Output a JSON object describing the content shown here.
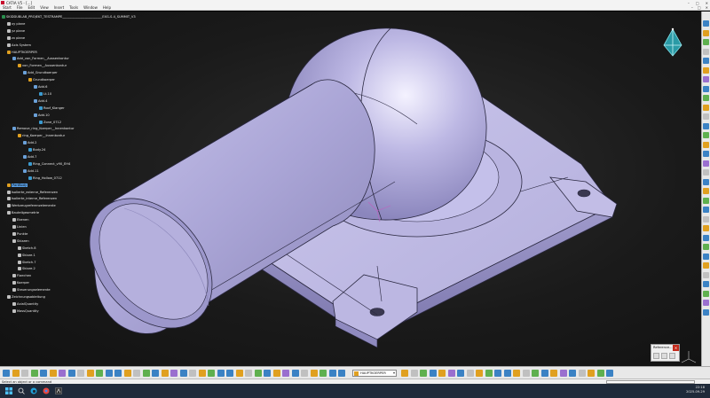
{
  "window": {
    "title": "CATIA V5 - [...]",
    "controls": [
      "–",
      "□",
      "✕"
    ]
  },
  "menu": {
    "items": [
      "Start",
      "File",
      "Edit",
      "View",
      "Insert",
      "Tools",
      "Window",
      "Help"
    ],
    "mdi_controls": [
      "–",
      "□",
      "✕"
    ]
  },
  "tree": {
    "nodes": [
      {
        "label": "SKIDDUBLAB_PROJEKT_TESTRAMPE_________________________EXG-S-4_SUMMIT_V3",
        "icon": "part",
        "depth": 0
      },
      {
        "label": "xy plane",
        "icon": "plane",
        "depth": 1
      },
      {
        "label": "yz plane",
        "icon": "plane",
        "depth": 1
      },
      {
        "label": "zx plane",
        "icon": "plane",
        "depth": 1
      },
      {
        "label": "Axis System",
        "icon": "axis",
        "depth": 1
      },
      {
        "label": "HAUPTKOERPER",
        "icon": "body",
        "depth": 1
      },
      {
        "label": "Add_von_Formen__Aussenkontur",
        "icon": "gear",
        "depth": 2
      },
      {
        "label": "von_Formen__Aussenkontur",
        "icon": "body",
        "depth": 3
      },
      {
        "label": "Add_Grundkoerper",
        "icon": "gear",
        "depth": 4
      },
      {
        "label": "Grundkoerper",
        "icon": "body",
        "depth": 5
      },
      {
        "label": "Add.6",
        "icon": "gear",
        "depth": 6
      },
      {
        "label": "Lt.10",
        "icon": "pad",
        "depth": 7
      },
      {
        "label": "Add.4",
        "icon": "gear",
        "depth": 6
      },
      {
        "label": "Roof_Klanger",
        "icon": "pad",
        "depth": 7
      },
      {
        "label": "Add.10",
        "icon": "gear",
        "depth": 6
      },
      {
        "label": "Zone_0712",
        "icon": "pad",
        "depth": 7
      },
      {
        "label": "Remove_ring_Koerper__Innenkontur",
        "icon": "gear",
        "depth": 2
      },
      {
        "label": "ring_Koerper__Innenkontur",
        "icon": "body",
        "depth": 3
      },
      {
        "label": "Add.2",
        "icon": "gear",
        "depth": 4
      },
      {
        "label": "Body.24",
        "icon": "pad",
        "depth": 5
      },
      {
        "label": "Add.7",
        "icon": "gear",
        "depth": 4
      },
      {
        "label": "Ring_Connect_v90_EH4",
        "icon": "pad",
        "depth": 5
      },
      {
        "label": "Add.11",
        "icon": "gear",
        "depth": 4
      },
      {
        "label": "Ring_Hollow_0712",
        "icon": "pad",
        "depth": 5
      },
      {
        "label": "PartBody",
        "icon": "body",
        "depth": 1,
        "highlight": true
      },
      {
        "label": "Isolierte_externe_Referenzen",
        "icon": "set",
        "depth": 1
      },
      {
        "label": "Isolierte_interne_Referenzen",
        "icon": "set",
        "depth": 1
      },
      {
        "label": "Werkzeugreferenzelemente",
        "icon": "set",
        "depth": 1
      },
      {
        "label": "Bauteilgeometrie",
        "icon": "set",
        "depth": 1
      },
      {
        "label": "Ebenen",
        "icon": "set",
        "depth": 2
      },
      {
        "label": "Linien",
        "icon": "set",
        "depth": 2
      },
      {
        "label": "Punkte",
        "icon": "set",
        "depth": 2
      },
      {
        "label": "Skizzen",
        "icon": "set",
        "depth": 2
      },
      {
        "label": "Sketch.8",
        "icon": "sketch",
        "depth": 3
      },
      {
        "label": "Skizze.1",
        "icon": "sketch",
        "depth": 3
      },
      {
        "label": "Sketch.7",
        "icon": "sketch",
        "depth": 3
      },
      {
        "label": "Skizze.2",
        "icon": "sketch",
        "depth": 3
      },
      {
        "label": "Flaechen",
        "icon": "set",
        "depth": 2
      },
      {
        "label": "Koerper",
        "icon": "set",
        "depth": 2
      },
      {
        "label": "Steuerungselemente",
        "icon": "set",
        "depth": 2
      },
      {
        "label": "Zeichnungsableitung",
        "icon": "set",
        "depth": 1
      },
      {
        "label": "AxialQuantity",
        "icon": "param",
        "depth": 2
      },
      {
        "label": "MassQuantity",
        "icon": "param",
        "depth": 2
      }
    ]
  },
  "reference_dialog": {
    "title": "Reference...",
    "close_label": "✕"
  },
  "bottom_toolbar": {
    "current_body": "HAUPTKOERPER"
  },
  "status": {
    "prompt": "Select an object or a command",
    "time": "22:18",
    "date": "2025-09-29"
  },
  "colors": {
    "model_face": "#b7b2dc",
    "viewport_bg": "#1c1c1c",
    "accent_red": "#c42b1c"
  }
}
